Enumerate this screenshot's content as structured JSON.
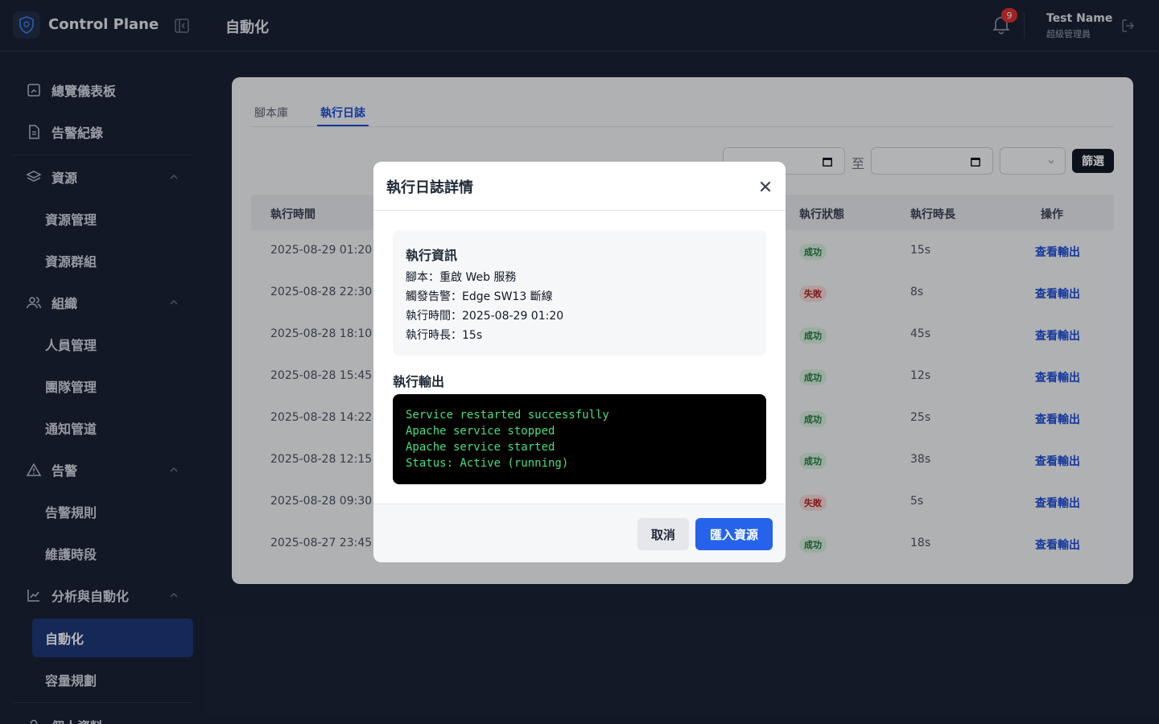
{
  "header": {
    "brand": "Control Plane",
    "page_title": "自動化",
    "notification_count": "9",
    "user_name": "Test Name",
    "user_role": "超級管理員"
  },
  "sidebar": {
    "items": [
      {
        "label": "總覽儀表板",
        "icon": "dashboard-icon"
      },
      {
        "label": "告警紀錄",
        "icon": "document-icon"
      },
      {
        "label": "資源",
        "icon": "layers-icon",
        "expanded": true
      },
      {
        "label": "資源管理"
      },
      {
        "label": "資源群組"
      },
      {
        "label": "組織",
        "icon": "users-icon",
        "expanded": true
      },
      {
        "label": "人員管理"
      },
      {
        "label": "團隊管理"
      },
      {
        "label": "通知管道"
      },
      {
        "label": "告警",
        "icon": "alert-triangle-icon",
        "expanded": true
      },
      {
        "label": "告警規則"
      },
      {
        "label": "維護時段"
      },
      {
        "label": "分析與自動化",
        "icon": "chart-line-icon",
        "expanded": true
      },
      {
        "label": "自動化",
        "active": true
      },
      {
        "label": "容量規劃"
      },
      {
        "label": "個人資料",
        "icon": "user-icon"
      }
    ]
  },
  "main": {
    "tabs": [
      {
        "label": "腳本庫",
        "active": false
      },
      {
        "label": "執行日誌",
        "active": true
      }
    ],
    "filter": {
      "to_label": "至",
      "button": "篩選"
    },
    "table": {
      "headers": [
        "執行時間",
        "執行狀態",
        "執行時長",
        "操作"
      ],
      "rows": [
        {
          "time": "2025-08-29 01:20",
          "status": "成功",
          "ok": true,
          "duration": "15s",
          "action": "查看輸出"
        },
        {
          "time": "2025-08-28 22:30",
          "status": "失敗",
          "ok": false,
          "duration": "8s",
          "action": "查看輸出"
        },
        {
          "time": "2025-08-28 18:10",
          "status": "成功",
          "ok": true,
          "duration": "45s",
          "action": "查看輸出"
        },
        {
          "time": "2025-08-28 15:45",
          "status": "成功",
          "ok": true,
          "duration": "12s",
          "action": "查看輸出"
        },
        {
          "time": "2025-08-28 14:22",
          "status": "成功",
          "ok": true,
          "duration": "25s",
          "action": "查看輸出"
        },
        {
          "time": "2025-08-28 12:15",
          "status": "成功",
          "ok": true,
          "duration": "38s",
          "action": "查看輸出"
        },
        {
          "time": "2025-08-28 09:30",
          "status": "失敗",
          "ok": false,
          "duration": "5s",
          "action": "查看輸出"
        },
        {
          "time": "2025-08-27 23:45",
          "status": "成功",
          "ok": true,
          "duration": "18s",
          "action": "查看輸出"
        }
      ]
    }
  },
  "modal": {
    "title": "執行日誌詳情",
    "info_title": "執行資訊",
    "info_lines": [
      "腳本：重啟 Web 服務",
      "觸發告警：Edge SW13 斷線",
      "執行時間：2025-08-29 01:20",
      "執行時長：15s"
    ],
    "output_title": "執行輸出",
    "output_lines": [
      "Service restarted successfully",
      "Apache service stopped",
      "Apache service started",
      "Status: Active (running)"
    ],
    "cancel_label": "取消",
    "primary_label": "匯入資源"
  },
  "colors": {
    "background": "#1a2234",
    "accent": "#2563eb",
    "success": "#1e7a3b",
    "failure": "#b42323",
    "terminal_text": "#4ade80"
  }
}
